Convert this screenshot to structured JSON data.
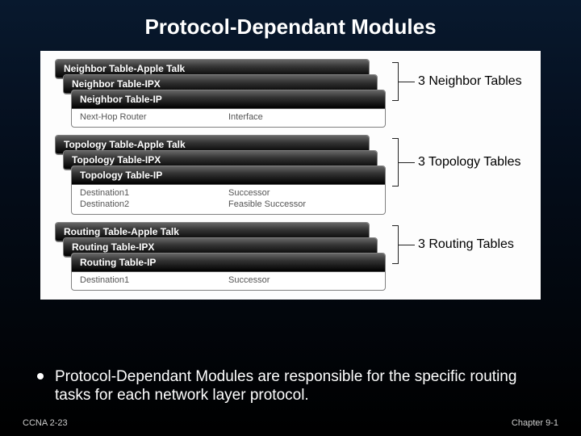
{
  "title": "Protocol-Dependant Modules",
  "groups": [
    {
      "annot": "3 Neighbor Tables",
      "cards": [
        {
          "header": "Neighbor Table-Apple Talk"
        },
        {
          "header": "Neighbor Table-IPX"
        },
        {
          "header": "Neighbor Table-IP",
          "rows": [
            [
              "Next-Hop Router",
              "Interface"
            ]
          ]
        }
      ]
    },
    {
      "annot": "3 Topology Tables",
      "cards": [
        {
          "header": "Topology Table-Apple Talk"
        },
        {
          "header": "Topology Table-IPX"
        },
        {
          "header": "Topology Table-IP",
          "rows": [
            [
              "Destination1",
              "Successor"
            ],
            [
              "Destination2",
              "Feasible Successor"
            ]
          ]
        }
      ]
    },
    {
      "annot": "3 Routing Tables",
      "cards": [
        {
          "header": "Routing Table-Apple Talk"
        },
        {
          "header": "Routing Table-IPX"
        },
        {
          "header": "Routing Table-IP",
          "rows": [
            [
              "Destination1",
              "Successor"
            ]
          ]
        }
      ]
    }
  ],
  "bullet": {
    "strong": "Protocol-Dependant Modules",
    "rest": " are responsible for the specific routing tasks for each network layer protocol."
  },
  "footer": {
    "left": "CCNA 2-23",
    "right": "Chapter  9-1"
  }
}
